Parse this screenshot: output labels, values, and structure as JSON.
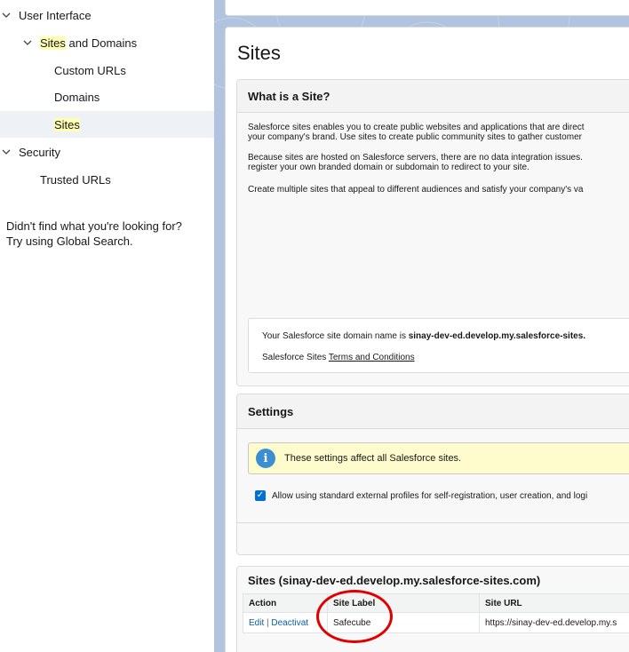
{
  "sidebar": {
    "items": [
      {
        "label": "User Interface",
        "level": 0,
        "expanded": true
      },
      {
        "label_highlight": "Sites",
        "label_rest": " and Domains",
        "level": 1,
        "expanded": true
      },
      {
        "label": "Custom URLs",
        "level": 2
      },
      {
        "label": "Domains",
        "level": 2
      },
      {
        "label": "Sites",
        "level": 2,
        "selected": true
      },
      {
        "label": "Security",
        "level": 0,
        "expanded": true
      },
      {
        "label": "Trusted URLs",
        "level": 1
      }
    ],
    "help_line1": "Didn't find what you're looking for?",
    "help_line2": "Try using Global Search."
  },
  "main": {
    "page_title": "Sites",
    "what_is": {
      "heading": "What is a Site?",
      "p1_line1": "Salesforce sites enables you to create public websites and applications that are direct",
      "p1_line2": "your company's brand. Use sites to create public community sites to gather customer",
      "p2_line1": "Because sites are hosted on Salesforce servers, there are no data integration issues.",
      "p2_line2": "register your own branded domain or subdomain to redirect to your site.",
      "p3": "Create multiple sites that appeal to different audiences and satisfy your company's va",
      "domain_prefix": "Your Salesforce site domain name is ",
      "domain_value": "sinay-dev-ed.develop.my.salesforce-sites.",
      "terms_prefix": "Salesforce Sites ",
      "terms_link": "Terms and Conditions"
    },
    "settings": {
      "heading": "Settings",
      "info_text": "These settings affect all Salesforce sites.",
      "checkbox_label": "Allow using standard external profiles for self-registration, user creation, and logi",
      "checkbox_checked": true
    },
    "sites_list": {
      "heading": "Sites (sinay-dev-ed.develop.my.salesforce-sites.com)",
      "columns": [
        "Action",
        "Site Label",
        "Site URL"
      ],
      "rows": [
        {
          "edit": "Edit",
          "separator": " | ",
          "deactivate": "Deactivat",
          "site_label": "Safecube",
          "site_url": "https://sinay-dev-ed.develop.my.s"
        }
      ]
    }
  },
  "colors": {
    "highlight": "#ffffb3",
    "selected_row": "#eef1f6",
    "background_blue": "#b0c4df",
    "annotation_red": "#e00000",
    "link": "#0b5cab"
  }
}
